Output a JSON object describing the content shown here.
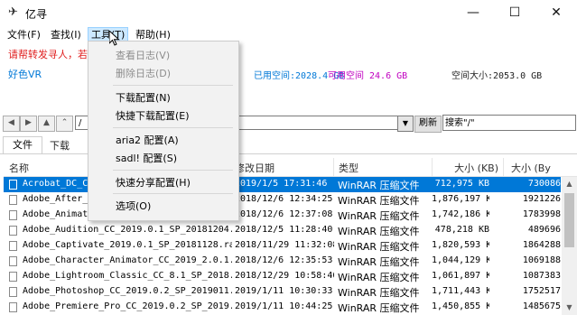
{
  "window": {
    "title": "亿寻",
    "min": "—",
    "max": "☐",
    "close": "✕"
  },
  "menubar": [
    {
      "label": "文件(F)"
    },
    {
      "label": "查找(I)"
    },
    {
      "label": "工具(T)"
    },
    {
      "label": "帮助(H)"
    }
  ],
  "info": {
    "warning": "请帮转发寻人，若",
    "nickname": "好色VR",
    "used": "已用空间:2028.4 GB",
    "available": "可用空间 24.6 GB",
    "space": "空间大小:2053.0 GB"
  },
  "nav": {
    "path": "/",
    "refresh": "刷新",
    "search": "搜索\"/\""
  },
  "tabs": [
    {
      "label": "文件"
    },
    {
      "label": "下载"
    }
  ],
  "list": {
    "columns": {
      "name": "名称",
      "date": "修改日期",
      "type": "类型",
      "size": "大小 (KB)",
      "size2": "大小 (By"
    },
    "rows": [
      {
        "name": "Acrobat_DC_C_",
        "date": "2019/1/5 17:31:46",
        "type": "WinRAR 压缩文件",
        "size": "712,975 KB",
        "size2": "730086",
        "selected": true
      },
      {
        "name": "Adobe_After_E",
        "date": "2018/12/6 12:34:25",
        "type": "WinRAR 压缩文件",
        "size": "1,876,197 KB",
        "size2": "1921226"
      },
      {
        "name": "Adobe_Animate",
        "date": "2018/12/6 12:37:08",
        "type": "WinRAR 压缩文件",
        "size": "1,742,186 KB",
        "size2": "1783998"
      },
      {
        "name": "Adobe_Audition_CC_2019.0.1_SP_20181204...",
        "date": "2018/12/5 11:28:40",
        "type": "WinRAR 压缩文件",
        "size": "478,218 KB",
        "size2": "489696"
      },
      {
        "name": "Adobe_Captivate_2019.0.1_SP_20181128.rar",
        "date": "2018/11/29 11:32:08",
        "type": "WinRAR 压缩文件",
        "size": "1,820,593 KB",
        "size2": "1864288"
      },
      {
        "name": "Adobe_Character_Animator_CC_2019_2.0.1...",
        "date": "2018/12/6 12:35:53",
        "type": "WinRAR 压缩文件",
        "size": "1,044,129 KB",
        "size2": "1069188"
      },
      {
        "name": "Adobe_Lightroom_Classic_CC_8.1_SP_2018...",
        "date": "2018/12/29 10:58:46",
        "type": "WinRAR 压缩文件",
        "size": "1,061,897 KB",
        "size2": "1087383"
      },
      {
        "name": "Adobe_Photoshop_CC_2019.0.2_SP_2019011...",
        "date": "2019/1/11 10:30:33",
        "type": "WinRAR 压缩文件",
        "size": "1,711,443 KB",
        "size2": "1752517"
      },
      {
        "name": "Adobe_Premiere_Pro_CC_2019.0.2_SP_2019...",
        "date": "2019/1/11 10:44:25",
        "type": "WinRAR 压缩文件",
        "size": "1,450,855 KB",
        "size2": "1485675"
      }
    ]
  },
  "dropdown": [
    {
      "label": "查看日志(V)",
      "disabled": true
    },
    {
      "label": "删除日志(D)",
      "disabled": true
    },
    {
      "sep": true
    },
    {
      "label": "下载配置(N)"
    },
    {
      "label": "快捷下载配置(E)"
    },
    {
      "sep": true
    },
    {
      "label": "aria2 配置(A)"
    },
    {
      "label": "sadl! 配置(S)"
    },
    {
      "sep": true
    },
    {
      "label": "快速分享配置(H)"
    },
    {
      "sep": true
    },
    {
      "label": "选项(O)"
    }
  ],
  "colors": {
    "accent": "#0078d7",
    "warning": "#e02020",
    "available": "#c000c0",
    "selection": "#0078d7"
  }
}
